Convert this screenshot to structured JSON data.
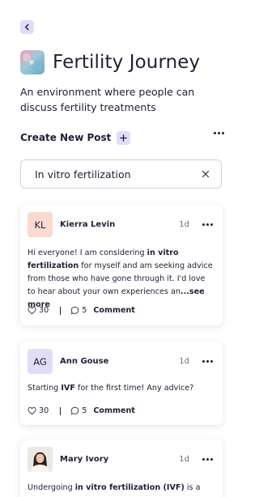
{
  "nav": {
    "back_icon": "chevron-left-icon"
  },
  "community": {
    "title": "Fertility Journey",
    "description": "An environment where people can discuss fertility treatments",
    "image_icon": "community-thumbnail"
  },
  "create_post": {
    "label": "Create New Post",
    "add_icon": "plus-icon",
    "more_icon": "more-horizontal-icon"
  },
  "search": {
    "value": "In vitro fertilization",
    "clear_icon": "close-icon"
  },
  "colors": {
    "accent_soft": "#e3dcf7",
    "avatar_pink": "#fbd9d1",
    "text": "#1f1f36"
  },
  "posts": [
    {
      "initials": "KL",
      "author": "Kierra Levin",
      "time": "1d",
      "text_1": "Hi everyone! I am considering ",
      "highlight_1": "in vitro fertilization",
      "text_2": " for myself and am seeking advice from those who have gone through it. I'd love to hear about your own experiences an",
      "see_more": "...see more",
      "likes": "30",
      "comments": "5",
      "comment_label": "Comment"
    },
    {
      "initials": "AG",
      "author": "Ann Gouse",
      "time": "1d",
      "text_1": "Starting ",
      "highlight_1": "IVF",
      "text_2": " for the first time! Any advice?",
      "likes": "30",
      "comments": "5",
      "comment_label": "Comment"
    },
    {
      "author": "Mary Ivory",
      "time": "1d",
      "text_1": "Undergoing ",
      "highlight_1": "in vitro fertilization (IVF)",
      "text_2": " is a"
    }
  ]
}
